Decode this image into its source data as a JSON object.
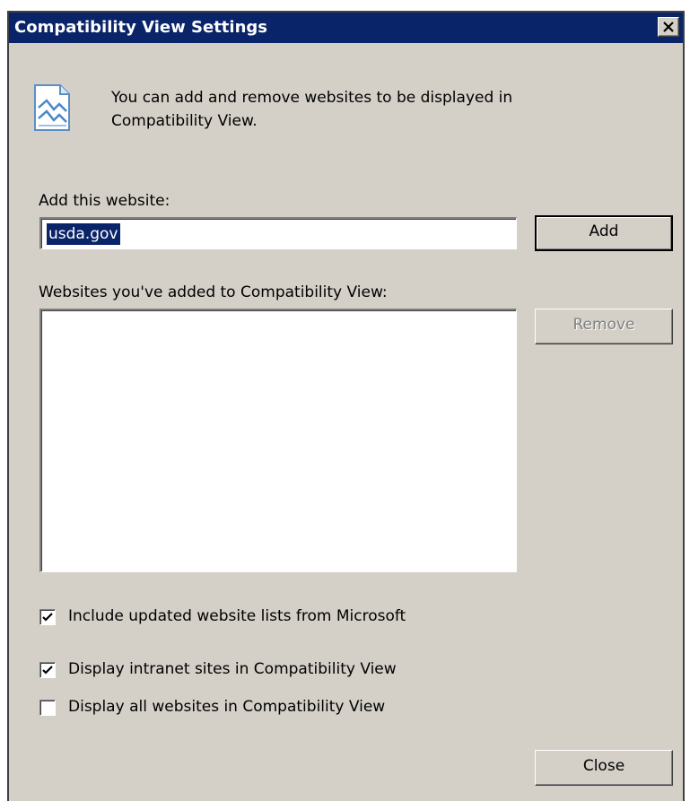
{
  "dialog": {
    "title": "Compatibility View Settings",
    "close_glyph": "✕"
  },
  "info": {
    "icon": "compatibility-view-icon",
    "text": "You can add and remove websites to be displayed in\nCompatibility View."
  },
  "add_site": {
    "label": "Add this website:",
    "value": "usda.gov",
    "button": "Add"
  },
  "site_list": {
    "label": "Websites you've added to Compatibility View:",
    "items": [],
    "remove_button": "Remove",
    "remove_enabled": false
  },
  "options": [
    {
      "label": "Include updated website lists from Microsoft",
      "checked": true
    },
    {
      "label": "Display intranet sites in Compatibility View",
      "checked": true
    },
    {
      "label": "Display all websites in Compatibility View",
      "checked": false
    }
  ],
  "close_button": "Close",
  "colors": {
    "title_bar": "#0a246a",
    "dialog_face": "#d4d0c8",
    "selection": "#0a246a",
    "disabled_text": "#808080"
  }
}
